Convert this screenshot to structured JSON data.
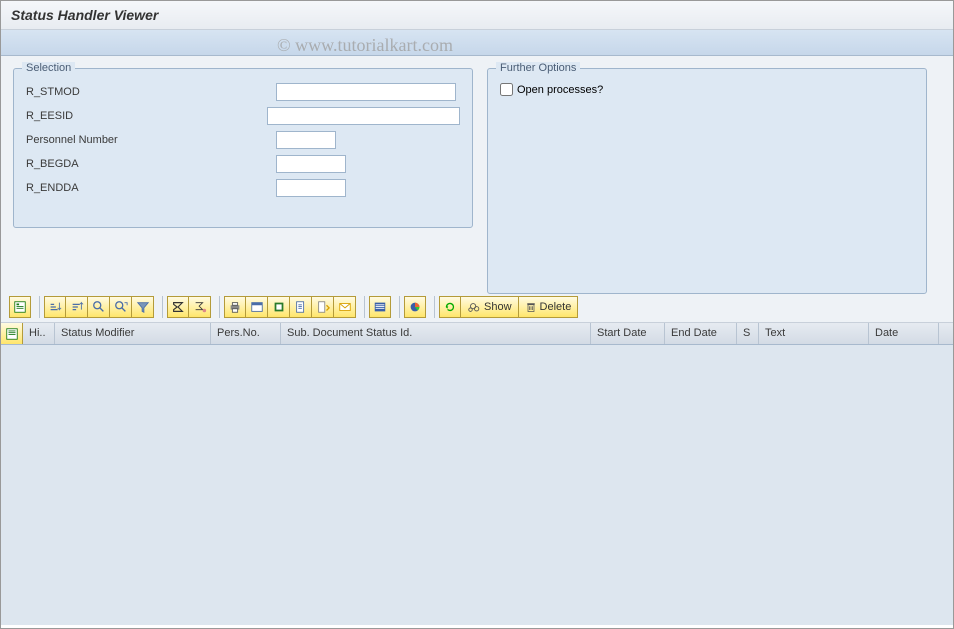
{
  "title": "Status Handler Viewer",
  "watermark": "© www.tutorialkart.com",
  "selection": {
    "legend": "Selection",
    "fields": {
      "stmod_label": "R_STMOD",
      "eesid_label": "R_EESID",
      "pernr_label": "Personnel Number",
      "begda_label": "R_BEGDA",
      "endda_label": "R_ENDDA"
    }
  },
  "options": {
    "legend": "Further Options",
    "open_processes_label": "Open processes?"
  },
  "toolbar": {
    "show_label": "Show",
    "delete_label": "Delete"
  },
  "grid": {
    "columns": {
      "hi": "Hi..",
      "status_modifier": "Status Modifier",
      "pers_no": "Pers.No.",
      "sub_doc": "Sub. Document Status Id.",
      "start_date": "Start Date",
      "end_date": "End Date",
      "s": "S",
      "text": "Text",
      "date": "Date"
    }
  }
}
